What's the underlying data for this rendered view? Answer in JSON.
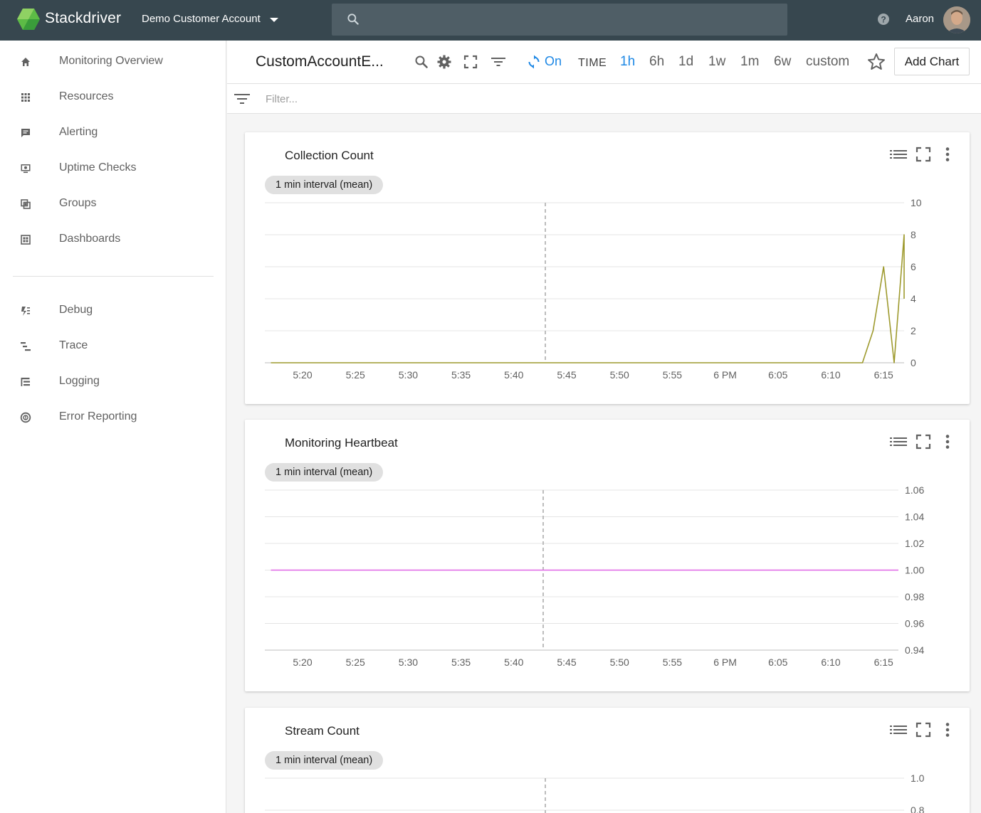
{
  "header": {
    "brand": "Stackdriver",
    "account": "Demo Customer Account",
    "username": "Aaron",
    "icons": {
      "logo": "stackdriver-logo-icon",
      "search": "search-icon",
      "help": "help-icon"
    }
  },
  "sidebar": {
    "items": [
      {
        "label": "Monitoring Overview",
        "icon": "home-icon"
      },
      {
        "label": "Resources",
        "icon": "grid-icon"
      },
      {
        "label": "Alerting",
        "icon": "alert-chat-icon"
      },
      {
        "label": "Uptime Checks",
        "icon": "monitor-icon"
      },
      {
        "label": "Groups",
        "icon": "groups-icon"
      },
      {
        "label": "Dashboards",
        "icon": "dashboard-icon"
      }
    ],
    "tools": [
      {
        "label": "Debug",
        "icon": "debug-icon"
      },
      {
        "label": "Trace",
        "icon": "trace-icon"
      },
      {
        "label": "Logging",
        "icon": "logging-icon"
      },
      {
        "label": "Error Reporting",
        "icon": "error-reporting-icon"
      }
    ]
  },
  "toolbar": {
    "title": "CustomAccountE...",
    "auto_refresh": "On",
    "time_label": "TIME",
    "time_options": [
      "1h",
      "6h",
      "1d",
      "1w",
      "1m",
      "6w",
      "custom"
    ],
    "active_time": "1h",
    "add_chart": "Add Chart"
  },
  "filter": {
    "placeholder": "Filter..."
  },
  "theme": {
    "topbar": "#37474f",
    "accent": "#1e88e5",
    "series1": "#9e9a2e",
    "series2": "#e066e6"
  },
  "chart_data": [
    {
      "type": "line",
      "title": "Collection Count",
      "aggregation": "1 min interval (mean)",
      "x_tick_labels": [
        "5:20",
        "5:25",
        "5:30",
        "5:35",
        "5:40",
        "5:45",
        "5:50",
        "5:55",
        "6 PM",
        "6:05",
        "6:10",
        "6:15"
      ],
      "y_tick_labels": [
        "10",
        "8",
        "6",
        "4",
        "2",
        "0"
      ],
      "ylim": [
        0,
        10
      ],
      "series": [
        {
          "color": "#9e9a2e",
          "x": [
            "5:17",
            "6:13",
            "6:14",
            "6:15",
            "6:16",
            "6:17",
            "6:18"
          ],
          "values": [
            0,
            0,
            2,
            6,
            0,
            8,
            4
          ]
        }
      ]
    },
    {
      "type": "line",
      "title": "Monitoring Heartbeat",
      "aggregation": "1 min interval (mean)",
      "x_tick_labels": [
        "5:20",
        "5:25",
        "5:30",
        "5:35",
        "5:40",
        "5:45",
        "5:50",
        "5:55",
        "6 PM",
        "6:05",
        "6:10",
        "6:15"
      ],
      "y_tick_labels": [
        "1.06",
        "1.04",
        "1.02",
        "1.00",
        "0.98",
        "0.96",
        "0.94"
      ],
      "ylim": [
        0.94,
        1.06
      ],
      "series": [
        {
          "color": "#e066e6",
          "x": [
            "5:17",
            "6:17"
          ],
          "values": [
            1.0,
            1.0
          ]
        }
      ]
    },
    {
      "type": "line",
      "title": "Stream Count",
      "aggregation": "1 min interval (mean)",
      "y_tick_labels": [
        "1.0",
        "0.8"
      ],
      "series": []
    }
  ]
}
